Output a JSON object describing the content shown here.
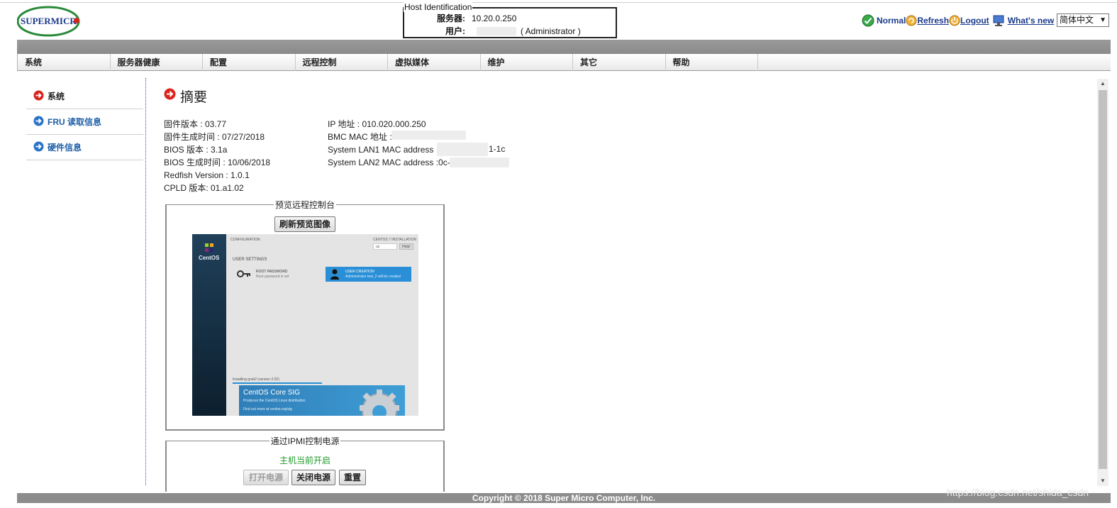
{
  "brand": {
    "logo_text": "SUPERMICRO",
    "color_red": "#d9251c",
    "color_green": "#2a8a3a",
    "color_blue": "#1a3a8a"
  },
  "host": {
    "legend": "Host Identification",
    "server_label": "服务器:",
    "server_value": "10.20.0.250",
    "user_label": "用户:",
    "user_role": "( Administrator )"
  },
  "status": {
    "normal": "Normal",
    "refresh": "Refresh",
    "logout": "Logout",
    "whats_new": "What's  new",
    "language": "简体中文",
    "icons": {
      "normal": "check-circle-icon",
      "refresh": "refresh-icon",
      "logout": "power-icon",
      "whats_new": "monitor-icon"
    }
  },
  "nav": {
    "items": [
      {
        "label": "系统"
      },
      {
        "label": "服务器健康"
      },
      {
        "label": "配置"
      },
      {
        "label": "远程控制"
      },
      {
        "label": "虚拟媒体"
      },
      {
        "label": "维护"
      },
      {
        "label": "其它"
      },
      {
        "label": "帮助"
      }
    ]
  },
  "sidebar": {
    "items": [
      {
        "label": "系统",
        "active": true
      },
      {
        "label": "FRU 读取信息",
        "active": false
      },
      {
        "label": "硬件信息",
        "active": false
      }
    ]
  },
  "main": {
    "title": "摘要",
    "info_left": [
      "固件版本 : 03.77",
      "固件生成时间 : 07/27/2018",
      "BIOS 版本 : 3.1a",
      "BIOS 生成时间 : 10/06/2018",
      "Redfish Version : 1.0.1",
      "CPLD 版本: 01.a1.02"
    ],
    "info_right": [
      "IP 地址 : 010.020.000.250",
      "BMC MAC 地址 :",
      "System LAN1 MAC address",
      "System LAN2 MAC address :0c-"
    ],
    "lan1_suffix": "1-1c",
    "preview": {
      "legend": "预览远程控制台",
      "refresh_button": "刷新预览图像",
      "screen": {
        "os_name": "CentOS",
        "configuration": "CONFIGURATION",
        "install_title": "CENTOS 7 INSTALLATION",
        "lang": "us",
        "help": "Help!",
        "user_settings": "USER SETTINGS",
        "root_password": "ROOT PASSWORD",
        "root_sub": "Root password is set",
        "user_creation": "USER CREATION",
        "user_sub": "Administrator test_2 will be created",
        "progress_text": "Installing grub2 (version 2.02)",
        "banner_title": "CentOS Core SIG",
        "banner_line1": "Produces the CentOS Linux distribution",
        "banner_line2": "Find out more at centos.org/sig"
      }
    },
    "power": {
      "legend": "通过IPMI控制电源",
      "status": "主机当前开启",
      "on_button": "打开电源",
      "off_button": "关闭电源",
      "reset_button": "重置"
    }
  },
  "footer": {
    "copyright": "Copyright © 2018 Super Micro Computer, Inc."
  },
  "watermark": "https://blog.csdn.net/shida_csdn"
}
